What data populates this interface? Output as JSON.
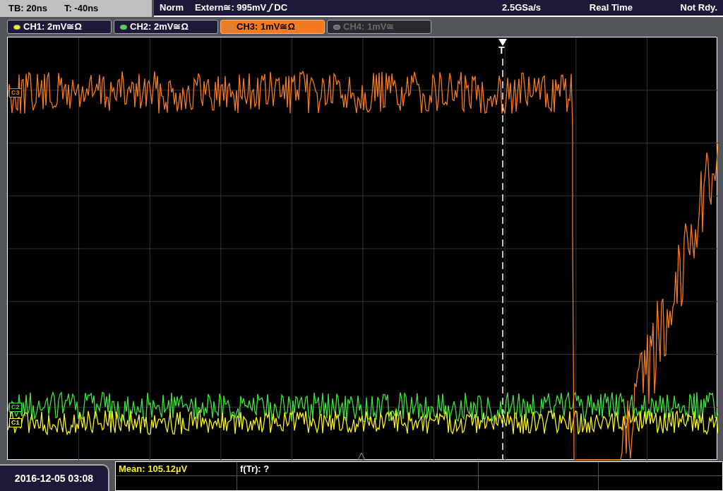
{
  "timebase": {
    "scale": "TB: 20ns",
    "position": "T: -40ns"
  },
  "trigger": {
    "mode": "Norm",
    "source": "Extern≅: 995mV",
    "coupling": "DC"
  },
  "acquisition": {
    "sample_rate": "2.5GSa/s",
    "mode": "Real Time",
    "status": "Not Rdy."
  },
  "channels": [
    {
      "label": "CH1: 2mV≅Ω",
      "color": "#f5f01e",
      "selected": false,
      "disabled": false
    },
    {
      "label": "CH2: 2mV≅Ω",
      "color": "#3de23d",
      "selected": false,
      "disabled": false
    },
    {
      "label": "CH3: 1mV≅Ω",
      "color": "#f47a20",
      "selected": true,
      "disabled": false
    },
    {
      "label": "CH4: 1mV≅",
      "color": "#6b6b6b",
      "selected": false,
      "disabled": true
    }
  ],
  "markers": [
    {
      "label": "C3",
      "color": "#f47a20"
    },
    {
      "label": "C2",
      "color": "#3de23d"
    },
    {
      "label": "C1",
      "color": "#f5f01e"
    }
  ],
  "trigger_marker": {
    "label": "T"
  },
  "date": "2016-12-05 03:08",
  "measurements": [
    {
      "text": "Mean: 105.12µV",
      "color": "#f5f01e"
    },
    {
      "text": "f(Tr): ?",
      "color": "#ffffff"
    }
  ]
}
